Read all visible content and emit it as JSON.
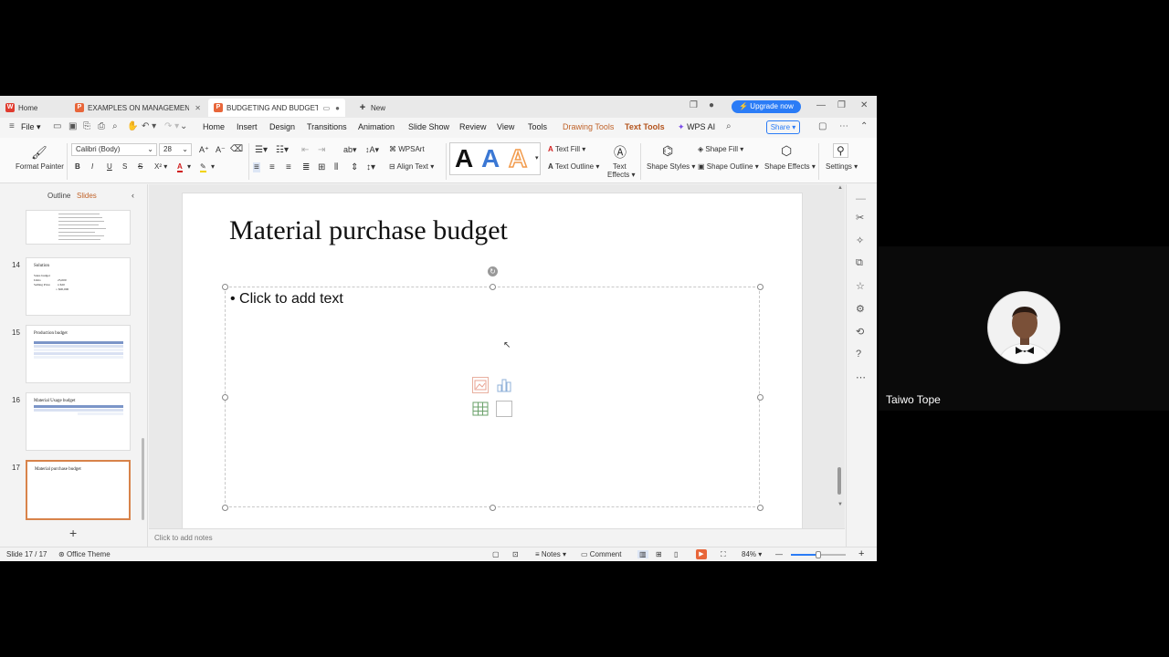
{
  "tabs": [
    {
      "label": "Home",
      "icon": "wps-logo-icon"
    },
    {
      "label": "EXAMPLES ON MANAGEMENT C",
      "icon": "presentation-icon"
    },
    {
      "label": "BUDGETING AND BUDGETA",
      "icon": "presentation-icon"
    },
    {
      "label": "New",
      "icon": "plus-icon"
    }
  ],
  "titlebar": {
    "upgrade": "Upgrade now"
  },
  "menu": {
    "file": "File",
    "items": [
      "Home",
      "Insert",
      "Design",
      "Transitions",
      "Animation",
      "Slide Show",
      "Review",
      "View",
      "Tools",
      "Drawing Tools",
      "Text Tools",
      "WPS AI"
    ],
    "share": "Share"
  },
  "ribbon": {
    "format_painter": "Format Painter",
    "font_name": "Calibri (Body)",
    "font_size": "28",
    "wpsart": "WPSArt",
    "align_text": "Align Text",
    "text_fill": "Text Fill",
    "text_outline": "Text Outline",
    "text_effects_1": "Text",
    "text_effects_2": "Effects",
    "shape_styles": "Shape Styles",
    "shape_fill": "Shape Fill",
    "shape_outline": "Shape Outline",
    "shape_effects": "Shape Effects",
    "settings": "Settings",
    "colors": {
      "a_black": "#111111",
      "a_blue": "#3b78d4",
      "a_orange": "#f29b4c",
      "accent": "#c0632a"
    }
  },
  "panel": {
    "outline_tab": "Outline",
    "slides_tab": "Slides",
    "slides": [
      {
        "num": "14",
        "title": "Solution",
        "lines": [
          "Sales budget",
          "Units",
          "Selling Price"
        ],
        "values": [
          "25,000",
          "x $20",
          "= $00,000"
        ]
      },
      {
        "num": "15",
        "title": "Production budget"
      },
      {
        "num": "16",
        "title": "Material Usage budget"
      },
      {
        "num": "17",
        "title": "Material purchase budget"
      }
    ]
  },
  "slide": {
    "title": "Material purchase budget",
    "placeholder": "Click to add text"
  },
  "notes": {
    "placeholder": "Click to add notes"
  },
  "status": {
    "slide_count": "Slide 17 / 17",
    "theme": "Office Theme",
    "notes": "Notes",
    "comment": "Comment",
    "zoom": "84%",
    "zoom_value": 0.5
  },
  "participant": {
    "name": "Taiwo Tope"
  }
}
